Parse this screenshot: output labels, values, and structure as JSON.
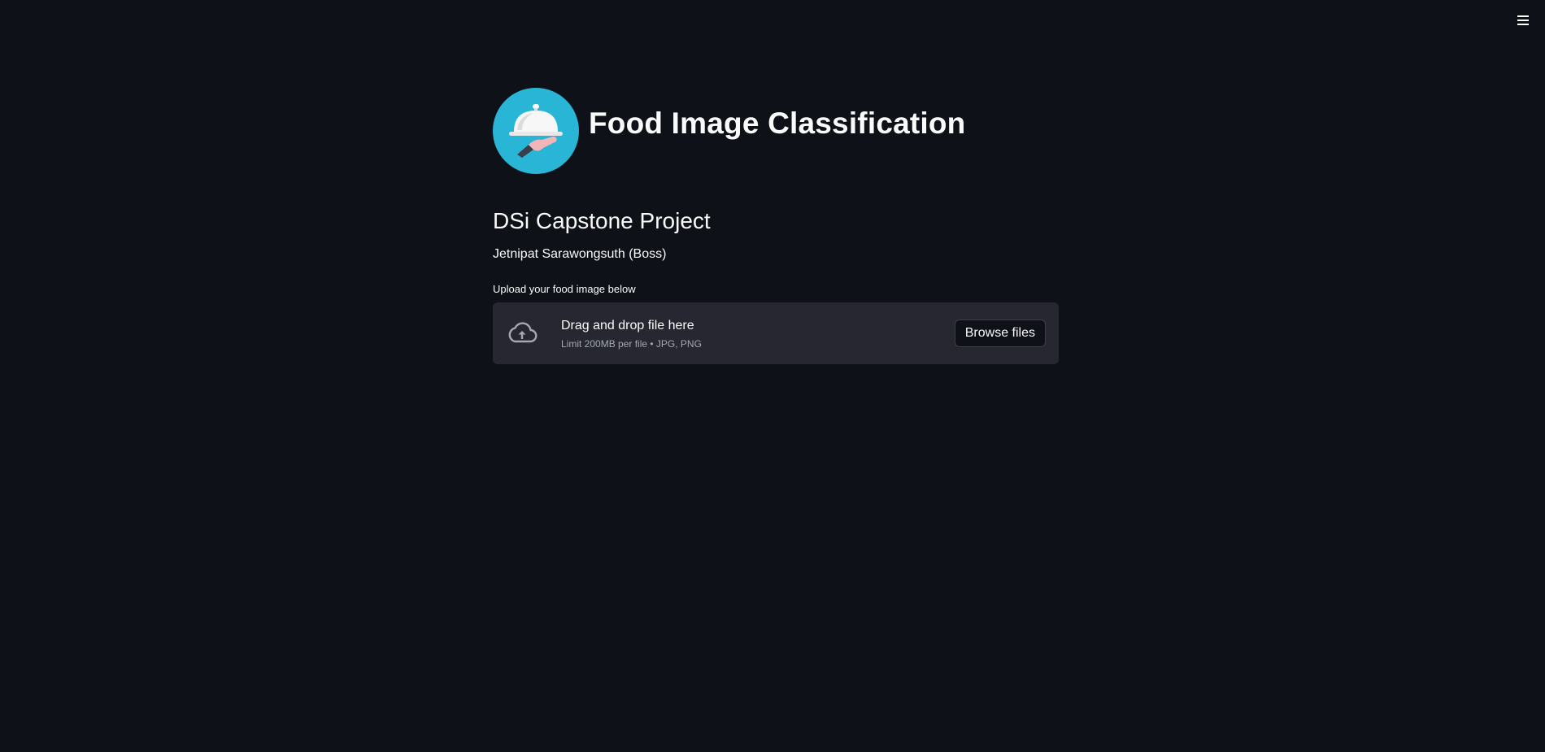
{
  "app": {
    "title": "Food Image Classification",
    "subheader": "DSi Capstone Project",
    "author": "Jetnipat Sarawongsuth (Boss)"
  },
  "uploader": {
    "label": "Upload your food image below",
    "instructions": "Drag and drop file here",
    "limit_text": "Limit 200MB per file • JPG, PNG",
    "browse_label": "Browse files"
  },
  "icons": {
    "menu": "hamburger-menu-icon",
    "logo": "food-cloche-logo",
    "upload": "cloud-upload-icon"
  },
  "colors": {
    "background": "#0e1117",
    "dropzone": "#262730",
    "logo_circle": "#29b6d6",
    "text": "#fafafa"
  }
}
